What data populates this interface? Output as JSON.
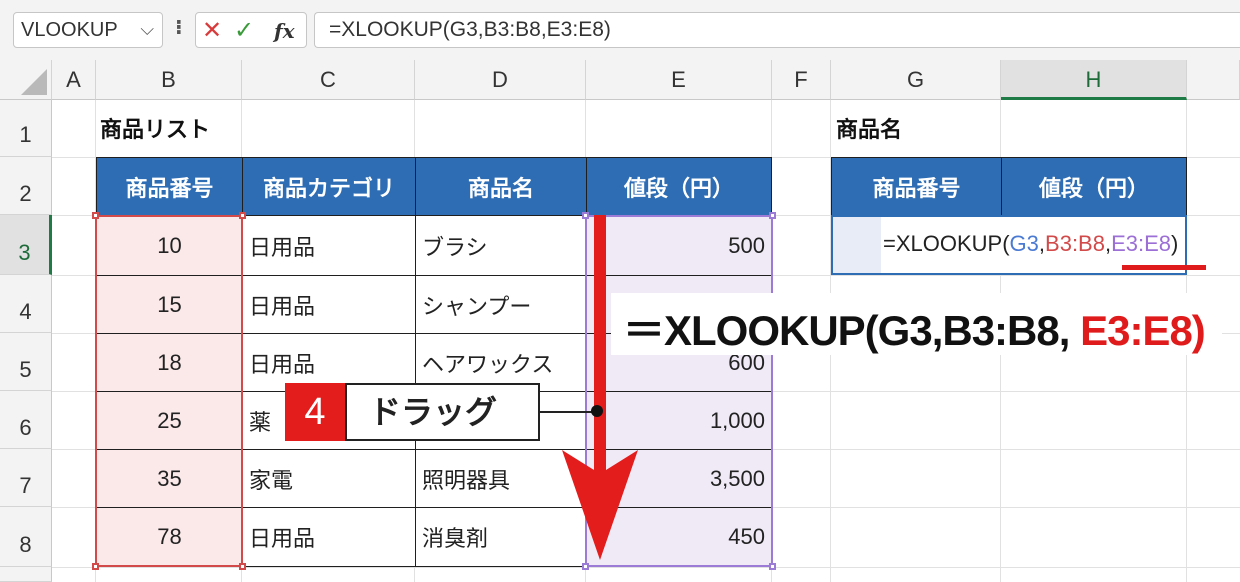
{
  "formula_bar": {
    "name_box": "VLOOKUP",
    "name_box_arrow": "⌵",
    "dots": "⁝",
    "cancel": "✕",
    "enter": "✓",
    "fx": "fx",
    "formula": "=XLOOKUP(G3,B3:B8,E3:E8)"
  },
  "columns": [
    "A",
    "B",
    "C",
    "D",
    "E",
    "F",
    "G",
    "H"
  ],
  "active_column": "H",
  "rows": [
    "1",
    "2",
    "3",
    "4",
    "5",
    "6",
    "7",
    "8"
  ],
  "active_row": "3",
  "sheet": {
    "list_title": "商品リスト",
    "lookup_title": "商品名",
    "table_headers": [
      "商品番号",
      "商品カテゴリ",
      "商品名",
      "値段（円）"
    ],
    "table_rows": [
      {
        "id": "10",
        "category": "日用品",
        "name": "ブラシ",
        "price": "500"
      },
      {
        "id": "15",
        "category": "日用品",
        "name": "シャンプー",
        "price": ""
      },
      {
        "id": "18",
        "category": "日用品",
        "name": "ヘアワックス",
        "price": "600"
      },
      {
        "id": "25",
        "category": "薬",
        "name": "",
        "price": "1,000"
      },
      {
        "id": "35",
        "category": "家電",
        "name": "照明器具",
        "price": "3,500"
      },
      {
        "id": "78",
        "category": "日用品",
        "name": "消臭剤",
        "price": "450"
      }
    ],
    "lookup_headers": [
      "商品番号",
      "値段（円）"
    ]
  },
  "edit_cell": {
    "prefix": "=XLOOKUP(",
    "arg1": "G3",
    "comma1": ",",
    "arg2": "B3:B8",
    "comma2": ",",
    "arg3": "E3:E8",
    "suffix": ")"
  },
  "callout": {
    "main": "＝XLOOKUP(G3,B3:B8, ",
    "highlight": "E3:E8)"
  },
  "step": {
    "number": "4",
    "label": "ドラッグ"
  },
  "colors": {
    "header_blue": "#2e6db4",
    "range_red": "#d24a4a",
    "range_purple": "#9b7bd6",
    "arrow_red": "#e31c1c",
    "active_green": "#1e7b45"
  }
}
